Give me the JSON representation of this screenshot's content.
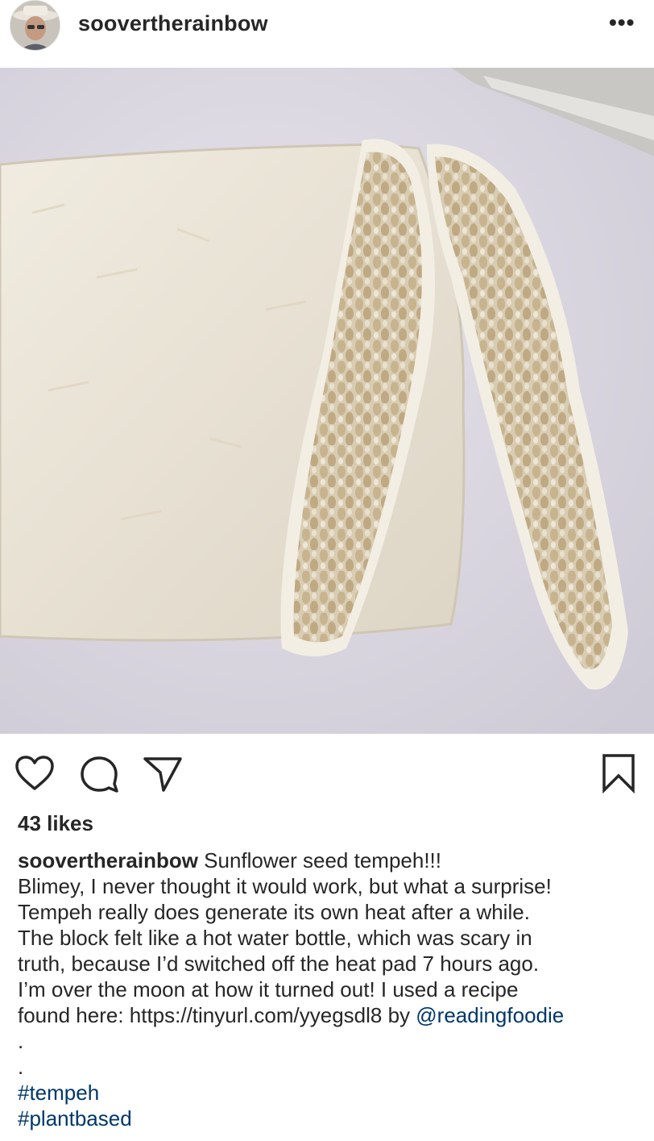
{
  "post": {
    "username": "soovertherainbow",
    "more_label": "•••",
    "likes": "43 likes",
    "caption": {
      "username": "soovertherainbow",
      "title": " Sunflower seed tempeh!!!",
      "lines": [
        "Blimey, I never thought it would work, but what a surprise!",
        "Tempeh really does generate its own heat after a while.",
        "The block felt like a hot water bottle, which was scary in",
        "truth, because I’d switched off the heat pad 7 hours ago.",
        "I’m over the moon at how it turned out!  I used a recipe"
      ],
      "last_line_text": "found here: https://tinyurl.com/yyegsdl8 by ",
      "mention": "@readingfoodie",
      "dots": [
        ".",
        "."
      ],
      "hashtags": [
        "#tempeh",
        "#plantbased"
      ]
    }
  },
  "icons": {
    "like": "heart-icon",
    "comment": "comment-icon",
    "share": "share-icon",
    "save": "bookmark-icon"
  },
  "colors": {
    "text": "#262626",
    "link": "#00376b"
  }
}
